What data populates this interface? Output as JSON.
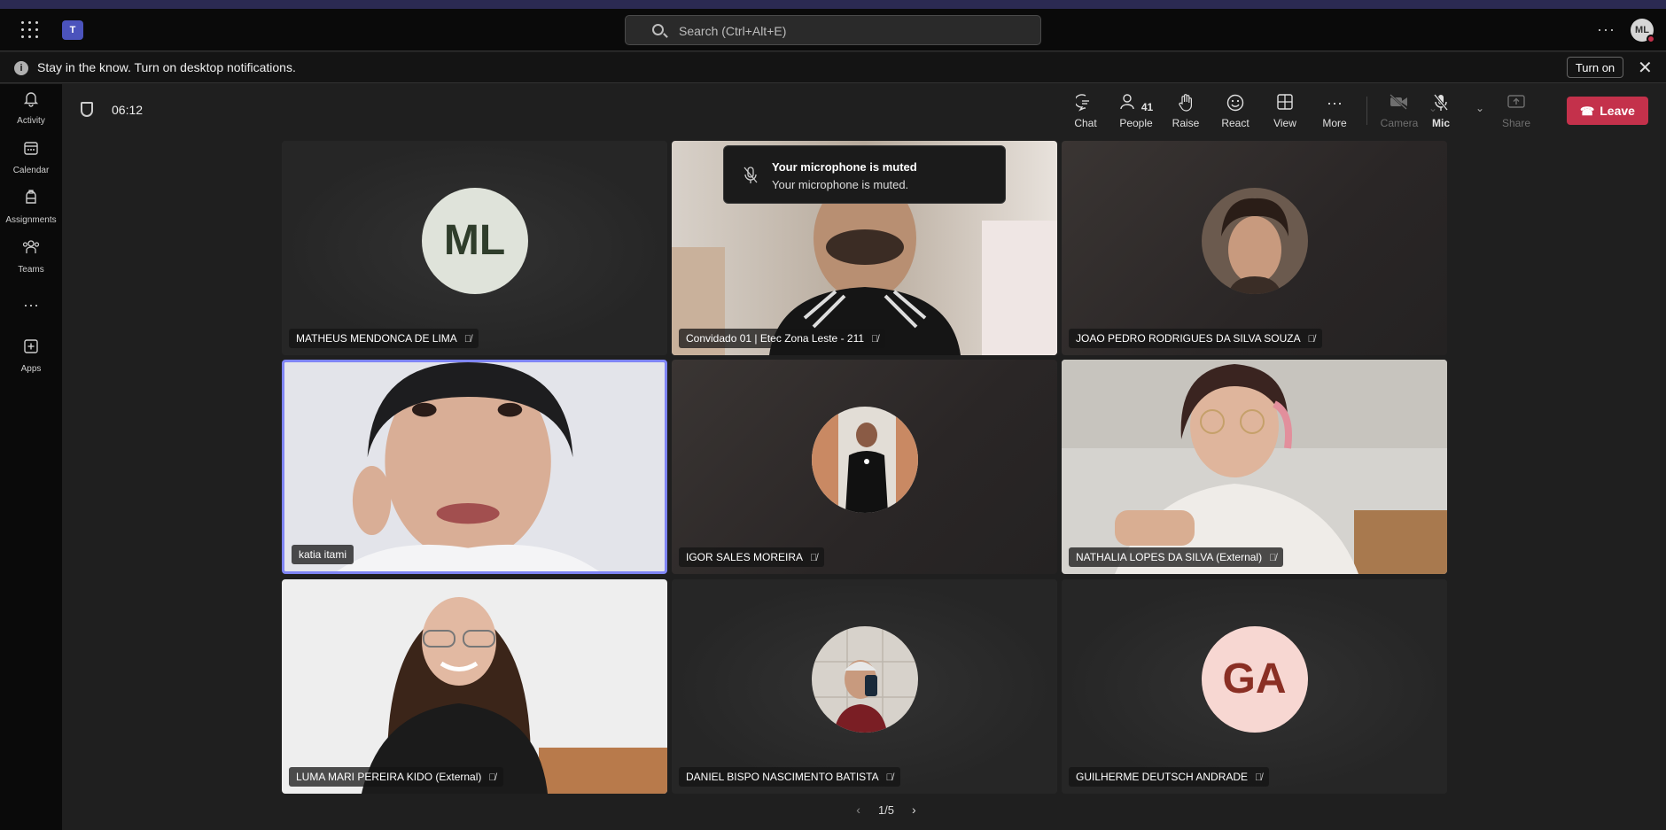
{
  "titlebar": {
    "search_placeholder": "Search (Ctrl+Alt+E)",
    "more": "···",
    "avatar_initials": "ML"
  },
  "notification": {
    "message": "Stay in the know. Turn on desktop notifications.",
    "turn_on": "Turn on",
    "close": "✕"
  },
  "rail": {
    "items": [
      {
        "label": "Activity",
        "icon": "bell-icon"
      },
      {
        "label": "Calendar",
        "icon": "calendar-icon"
      },
      {
        "label": "Assignments",
        "icon": "assignments-icon"
      },
      {
        "label": "Teams",
        "icon": "teams-icon"
      },
      {
        "label": "",
        "icon": "more-icon"
      },
      {
        "label": "Apps",
        "icon": "add-apps-icon"
      }
    ]
  },
  "meeting": {
    "timer": "06:12",
    "controls": {
      "chat": "Chat",
      "people": "People",
      "people_count": "41",
      "raise": "Raise",
      "react": "React",
      "view": "View",
      "more": "More",
      "camera": "Camera",
      "mic": "Mic",
      "share": "Share",
      "leave": "Leave"
    },
    "toast": {
      "title": "Your microphone is muted",
      "body": "Your microphone is muted."
    },
    "participants": [
      {
        "name": "MATHEUS MENDONCA DE LIMA",
        "initials": "ML",
        "muted": true
      },
      {
        "name": "Convidado 01 | Etec Zona Leste - 211",
        "muted": true
      },
      {
        "name": "JOAO PEDRO RODRIGUES DA SILVA SOUZA",
        "muted": true
      },
      {
        "name": "katia itami",
        "muted": false,
        "speaking": true
      },
      {
        "name": "IGOR SALES MOREIRA",
        "muted": true
      },
      {
        "name": "NATHALIA LOPES DA SILVA (External)",
        "muted": true
      },
      {
        "name": "LUMA MARI PEREIRA KIDO (External)",
        "muted": true
      },
      {
        "name": "DANIEL BISPO NASCIMENTO BATISTA",
        "muted": true
      },
      {
        "name": "GUILHERME DEUTSCH ANDRADE",
        "initials": "GA",
        "muted": true
      }
    ],
    "pager": "1/5"
  },
  "colors": {
    "accent": "#7f85f5",
    "leave": "#c4314b",
    "teams_brand": "#4b53bc"
  }
}
